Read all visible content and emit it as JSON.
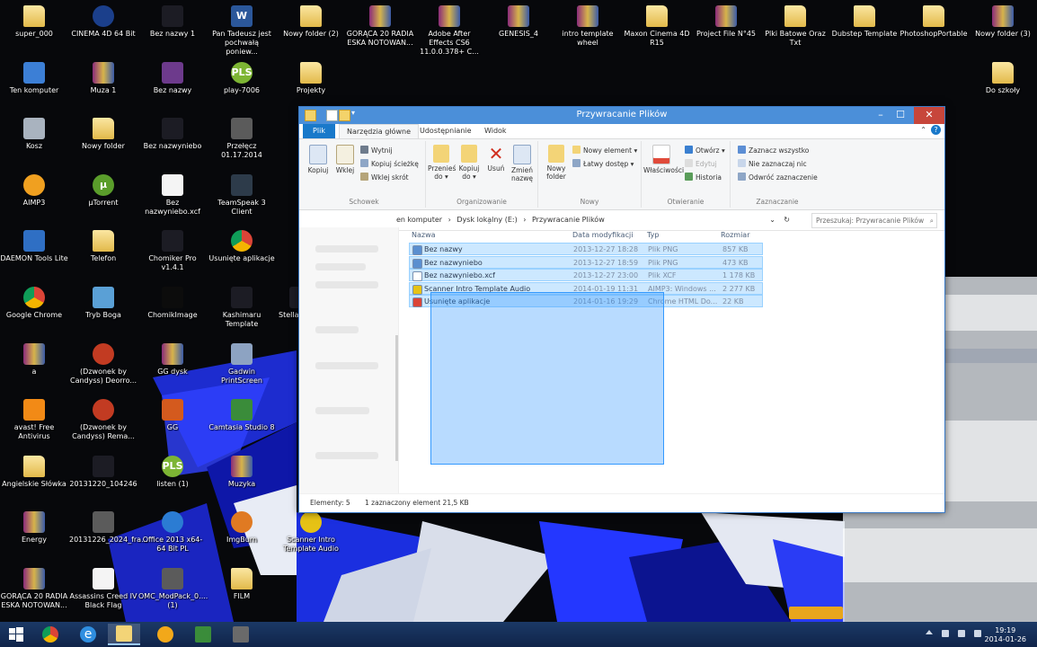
{
  "desktop": {
    "icons": [
      {
        "label": "super_000",
        "glyph": "",
        "kind": "folder"
      },
      {
        "label": "CINEMA 4D 64 Bit",
        "glyph": "",
        "kind": "c4d"
      },
      {
        "label": "Bez nazwy 1",
        "glyph": "",
        "kind": "dark"
      },
      {
        "label": "Pan Tadeusz jest pochwałą poniew...",
        "glyph": "W",
        "kind": "doc"
      },
      {
        "label": "Nowy folder (2)",
        "glyph": "",
        "kind": "folder"
      },
      {
        "label": "GORĄCA 20 RADIA ESKA NOTOWAN...",
        "glyph": "",
        "kind": "winrar"
      },
      {
        "label": "Adobe After Effects CS6 11.0.0.378+ C...",
        "glyph": "",
        "kind": "winrar"
      },
      {
        "label": "GENESIS_4",
        "glyph": "",
        "kind": "winrar"
      },
      {
        "label": "intro template wheel",
        "glyph": "",
        "kind": "winrar"
      },
      {
        "label": "Maxon Cinema 4D R15",
        "glyph": "",
        "kind": "folder"
      },
      {
        "label": "Project File N°45",
        "glyph": "",
        "kind": "winrar"
      },
      {
        "label": "Plki Batowe Oraz Txt",
        "glyph": "",
        "kind": "folder"
      },
      {
        "label": "Dubstep Template",
        "glyph": "",
        "kind": "folder"
      },
      {
        "label": "PhotoshopPortable",
        "glyph": "",
        "kind": "folder"
      },
      {
        "label": "Nowy folder (3)",
        "glyph": "",
        "kind": "winrar"
      },
      {
        "label": "Ten komputer",
        "glyph": "",
        "kind": "pc"
      },
      {
        "label": "Muza 1",
        "glyph": "",
        "kind": "winrar"
      },
      {
        "label": "Bez nazwy",
        "glyph": "",
        "kind": "purple"
      },
      {
        "label": "play-7006",
        "glyph": "PLS",
        "kind": "green"
      },
      {
        "label": "Projekty",
        "glyph": "",
        "kind": "folder"
      },
      {
        "label": "Do szkoły",
        "glyph": "",
        "kind": "folder"
      },
      {
        "label": "Kosz",
        "glyph": "",
        "kind": "bin"
      },
      {
        "label": "Nowy folder",
        "glyph": "",
        "kind": "folder"
      },
      {
        "label": "Bez nazwyniebo",
        "glyph": "",
        "kind": "dark"
      },
      {
        "label": "Przełęcz 01.17.2014",
        "glyph": "",
        "kind": "tank"
      },
      {
        "label": "AIMP3",
        "glyph": "",
        "kind": "aimp"
      },
      {
        "label": "µTorrent",
        "glyph": "µ",
        "kind": "utor"
      },
      {
        "label": "Bez nazwyniebo.xcf",
        "glyph": "",
        "kind": "white"
      },
      {
        "label": "TeamSpeak 3 Client",
        "glyph": "",
        "kind": "ts"
      },
      {
        "label": "DAEMON Tools Lite",
        "glyph": "",
        "kind": "daemon"
      },
      {
        "label": "Telefon",
        "glyph": "",
        "kind": "folder"
      },
      {
        "label": "Chomiker Pro v1.4.1",
        "glyph": "",
        "kind": "dark"
      },
      {
        "label": "Usunięte aplikacje",
        "glyph": "",
        "kind": "chrome"
      },
      {
        "label": "Google Chrome",
        "glyph": "",
        "kind": "chrome"
      },
      {
        "label": "Tryb Boga",
        "glyph": "",
        "kind": "calc"
      },
      {
        "label": "ChomikImage",
        "glyph": "",
        "kind": "black"
      },
      {
        "label": "Kashimaru Template",
        "glyph": "",
        "kind": "dark"
      },
      {
        "label": "Stella Se P...",
        "glyph": "",
        "kind": "dark"
      },
      {
        "label": "a",
        "glyph": "",
        "kind": "winrar"
      },
      {
        "label": "(Dzwonek by Candyss) Deorro...",
        "glyph": "",
        "kind": "red"
      },
      {
        "label": "GG dysk",
        "glyph": "",
        "kind": "winrar"
      },
      {
        "label": "Gadwin PrintScreen",
        "glyph": "",
        "kind": "gadwin"
      },
      {
        "label": "avast! Free Antivirus",
        "glyph": "",
        "kind": "avast"
      },
      {
        "label": "(Dzwonek by Candyss) Rema...",
        "glyph": "",
        "kind": "red"
      },
      {
        "label": "GG",
        "glyph": "",
        "kind": "orange"
      },
      {
        "label": "Camtasia Studio 8",
        "glyph": "",
        "kind": "camtasia"
      },
      {
        "label": "Angielskie Słówka",
        "glyph": "",
        "kind": "folder"
      },
      {
        "label": "20131220_104246",
        "glyph": "",
        "kind": "dark"
      },
      {
        "label": "listen (1)",
        "glyph": "PLS",
        "kind": "green"
      },
      {
        "label": "Muzyka",
        "glyph": "",
        "kind": "winrar"
      },
      {
        "label": "Energy",
        "glyph": "",
        "kind": "winrar"
      },
      {
        "label": "20131226_2024_fra...",
        "glyph": "",
        "kind": "tank"
      },
      {
        "label": "Office 2013 x64-64 Bit PL",
        "glyph": "",
        "kind": "office"
      },
      {
        "label": "ImgBurn",
        "glyph": "",
        "kind": "imgburn"
      },
      {
        "label": "Scanner Intro Template Audio",
        "glyph": "",
        "kind": "scanner"
      },
      {
        "label": "GORĄCA 20 RADIA ESKA NOTOWAN...",
        "glyph": "",
        "kind": "winrar"
      },
      {
        "label": "Assassins Creed IV Black Flag",
        "glyph": "",
        "kind": "white"
      },
      {
        "label": "OMC_ModPack_0.... (1)",
        "glyph": "",
        "kind": "tank"
      },
      {
        "label": "FILM",
        "glyph": "",
        "kind": "folder"
      }
    ]
  },
  "explorer": {
    "title": "Przywracanie Plików",
    "tabs": {
      "plik": "Plik",
      "narzedzia": "Narzędzia główne",
      "udostepnianie": "Udostępnianie",
      "widok": "Widok"
    },
    "ribbon": {
      "schowek": {
        "group_label": "Schowek",
        "kopiuj": "Kopiuj",
        "wklej": "Wklej",
        "wytnij": "Wytnij",
        "kopiuj_sciezke": "Kopiuj ścieżkę",
        "wklej_skrot": "Wklej skrót"
      },
      "organizowanie": {
        "group_label": "Organizowanie",
        "przenies": "Przenieś do ▾",
        "kopiuj_do": "Kopiuj do ▾",
        "usun": "Usuń",
        "zmien": "Zmień nazwę"
      },
      "nowy": {
        "group_label": "Nowy",
        "nowy_folder": "Nowy folder",
        "nowy_element": "Nowy element ▾",
        "latwy_dostep": "Łatwy dostęp ▾"
      },
      "otwieranie": {
        "group_label": "Otwieranie",
        "wlasciwosci": "Właściwości",
        "otworz": "Otwórz ▾",
        "edytuj": "Edytuj",
        "historia": "Historia"
      },
      "zaznaczanie": {
        "group_label": "Zaznaczanie",
        "zaznacz_wszystko": "Zaznacz wszystko",
        "nie_zaznaczaj": "Nie zaznaczaj nic",
        "odwroc": "Odwróć zaznaczenie"
      }
    },
    "address": {
      "seg1": "en komputer",
      "sep1": "›",
      "seg2": "Dysk lokalny (E:)",
      "sep2": "›",
      "seg3": "Przywracanie Plików"
    },
    "search_placeholder": "Przeszukaj: Przywracanie Plików",
    "columns": {
      "name": "Nazwa",
      "date": "Data modyfikacji",
      "type": "Typ",
      "size": "Rozmiar"
    },
    "files": [
      {
        "name": "Bez nazwy",
        "date": "2013-12-27 18:28",
        "type": "Plik PNG",
        "size": "857 KB",
        "color": "#5a8fd0"
      },
      {
        "name": "Bez nazwyniebo",
        "date": "2013-12-27 18:59",
        "type": "Plik PNG",
        "size": "473 KB",
        "color": "#5a8fd0"
      },
      {
        "name": "Bez nazwyniebo.xcf",
        "date": "2013-12-27 23:00",
        "type": "Plik XCF",
        "size": "1 178 KB",
        "color": "#ffffff"
      },
      {
        "name": "Scanner Intro Template Audio",
        "date": "2014-01-19 11:31",
        "type": "AIMP3: Windows ...",
        "size": "2 277 KB",
        "color": "#e6c215"
      },
      {
        "name": "Usunięte aplikacje",
        "date": "2014-01-16 19:29",
        "type": "Chrome HTML Do...",
        "size": "22 KB",
        "color": "#db4437"
      }
    ],
    "status": {
      "elements": "Elementy: 5",
      "selected": "1 zaznaczony element  21,5 KB"
    }
  },
  "taskbar": {
    "apps": [
      "start",
      "chrome",
      "internet-explorer",
      "file-explorer",
      "gg",
      "camtasia",
      "tanks"
    ],
    "clock_time": "19:19",
    "clock_date": "2014-01-26"
  }
}
